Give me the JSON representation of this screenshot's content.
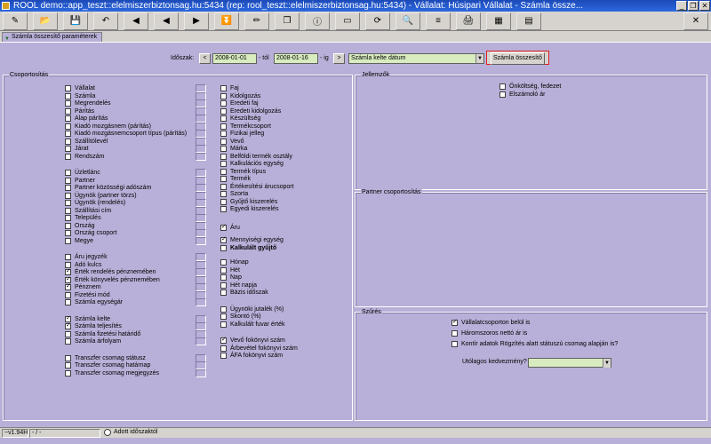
{
  "window": {
    "title": "ROOL demo::app_teszt::elelmiszerbiztonsag.hu:5434 (rep: rool_teszt::elelmiszerbiztonsag.hu:5434) - Vállalat: Húsipari Vállalat - Számla össze..."
  },
  "toolbar": {
    "icons": [
      "edit-icon",
      "open-icon",
      "save-icon",
      "undo-icon",
      "first-icon",
      "prev-icon",
      "next-icon",
      "last-icon",
      "pencil-icon",
      "copy-icon",
      "info-icon",
      "form-icon",
      "refresh-icon",
      "search-icon",
      "filter-icon",
      "print-icon",
      "grid-icon",
      "table-icon",
      "close-icon"
    ],
    "glyphs": [
      "✎",
      "📂",
      "💾",
      "↶",
      "◀",
      "◀",
      "▶",
      "⏬",
      "✏",
      "❐",
      "ⓘ",
      "▭",
      "⟳",
      "🔍",
      "≡",
      "🖨",
      "▦",
      "▤",
      "✕"
    ]
  },
  "tab": {
    "label": "Számla összesítő paraméterek"
  },
  "params": {
    "period_label": "Időszak:",
    "from_date": "2008-01-01",
    "from_suffix": "- tól",
    "to_date": "2008-01-16",
    "to_suffix": "- ig",
    "date_type": "Számla kelte dátum",
    "summary_button": "Számla összesítő",
    "prev_glyph": "<",
    "next_glyph": ">"
  },
  "grouping": {
    "title": "Csoportosítás",
    "col1": [
      {
        "label": "Vállalat",
        "checked": false
      },
      {
        "label": "Számla",
        "checked": false
      },
      {
        "label": "Megrendelés",
        "checked": false
      },
      {
        "label": "Párítás",
        "checked": false
      },
      {
        "label": "Alap párítás",
        "checked": false
      },
      {
        "label": "Kiadó mozgásnem (párítás)",
        "checked": false
      },
      {
        "label": "Kiadó mozgásnemcsoport típus (párítás)",
        "checked": false
      },
      {
        "label": "Szállítólevél",
        "checked": false
      },
      {
        "label": "Járat",
        "checked": false
      },
      {
        "label": "Rendszám",
        "checked": false
      },
      {
        "label": "Üzletlánc",
        "checked": false
      },
      {
        "label": "Partner",
        "checked": false
      },
      {
        "label": "Partner közösségi adószám",
        "checked": false
      },
      {
        "label": "Ügynök (partner törzs)",
        "checked": false
      },
      {
        "label": "Ügynök (rendelés)",
        "checked": false
      },
      {
        "label": "Szállítási cím",
        "checked": false
      },
      {
        "label": "Település",
        "checked": false
      },
      {
        "label": "Ország",
        "checked": false
      },
      {
        "label": "Ország csoport",
        "checked": false
      },
      {
        "label": "Megye",
        "checked": false
      },
      {
        "label": "Áru jegyzék",
        "checked": false
      },
      {
        "label": "Adó kulcs",
        "checked": false
      },
      {
        "label": "Érték rendelés pénznemében",
        "checked": true
      },
      {
        "label": "Érték könyvelés pénznemében",
        "checked": true
      },
      {
        "label": "Pénznem",
        "checked": true
      },
      {
        "label": "Fizetési mód",
        "checked": false
      },
      {
        "label": "Számla egységár",
        "checked": false
      },
      {
        "label": "Számla kelte",
        "checked": true
      },
      {
        "label": "Számla teljesítés",
        "checked": true
      },
      {
        "label": "Számla fizetési határidő",
        "checked": false
      },
      {
        "label": "Számla árfolyam",
        "checked": false
      },
      {
        "label": "Transzfer csomag státusz",
        "checked": false
      },
      {
        "label": "Transzfer csomag határnap",
        "checked": false
      },
      {
        "label": "Transzfer csomag megjegyzés",
        "checked": false
      }
    ],
    "col2": [
      {
        "label": "Faj",
        "checked": false
      },
      {
        "label": "Kidolgozás",
        "checked": false
      },
      {
        "label": "Eredeti faj",
        "checked": false
      },
      {
        "label": "Eredeti kidolgozás",
        "checked": false
      },
      {
        "label": "Készültség",
        "checked": false
      },
      {
        "label": "Termékcsoport",
        "checked": false
      },
      {
        "label": "Fizikai jelleg",
        "checked": false
      },
      {
        "label": "Vevő",
        "checked": false
      },
      {
        "label": "Márka",
        "checked": false
      },
      {
        "label": "Belföldi termék osztály",
        "checked": false
      },
      {
        "label": "Kalkulációs egység",
        "checked": false
      },
      {
        "label": "Termék típus",
        "checked": false
      },
      {
        "label": "Termék",
        "checked": false
      },
      {
        "label": "Értékesítési árucsoport",
        "checked": false
      },
      {
        "label": "Szorta",
        "checked": false
      },
      {
        "label": "Gyűjtő kiszerelés",
        "checked": false
      },
      {
        "label": "Egyedi kiszerelés",
        "checked": false
      },
      {
        "label": "Áru",
        "checked": true
      },
      {
        "label": "Mennyiségi egység",
        "checked": true
      },
      {
        "label": "Kalkulált gyűjtő",
        "checked": false
      },
      {
        "label": "Hónap",
        "checked": false
      },
      {
        "label": "Hét",
        "checked": false
      },
      {
        "label": "Nap",
        "checked": false
      },
      {
        "label": "Hét napja",
        "checked": false
      },
      {
        "label": "Bázis időszak",
        "checked": false
      },
      {
        "label": "Ügynöki jutalék (%)",
        "checked": false
      },
      {
        "label": "Skontó (%)",
        "checked": false
      },
      {
        "label": "Kalkulált fuvar érték",
        "checked": false
      },
      {
        "label": "Vevő fokönyvi szám",
        "checked": true
      },
      {
        "label": "Árbevétel fokönyvi szám",
        "checked": false
      },
      {
        "label": "ÁFA fokönyvi szám",
        "checked": false
      }
    ]
  },
  "features": {
    "title": "Jellemzők",
    "items": [
      {
        "label": "Önköltség, fedezet",
        "checked": false
      },
      {
        "label": "Elszámoló ár",
        "checked": false
      }
    ]
  },
  "partner_grouping": {
    "title": "Partner csoportosítás"
  },
  "filter": {
    "title": "Szűrés",
    "items": [
      {
        "label": "Vállalatcsoporton belül is",
        "checked": true
      },
      {
        "label": "Háromszoros nettó ár is",
        "checked": false
      },
      {
        "label": "Kontír adatok Rögzítés alatt státuszú csomag alapján is?",
        "checked": false
      }
    ],
    "discount_label": "Utólagos kedvezmény?",
    "discount_value": ""
  },
  "status": {
    "version": "~v1.94H",
    "mode": "- / -",
    "added_label": "Adott időszaktól"
  }
}
